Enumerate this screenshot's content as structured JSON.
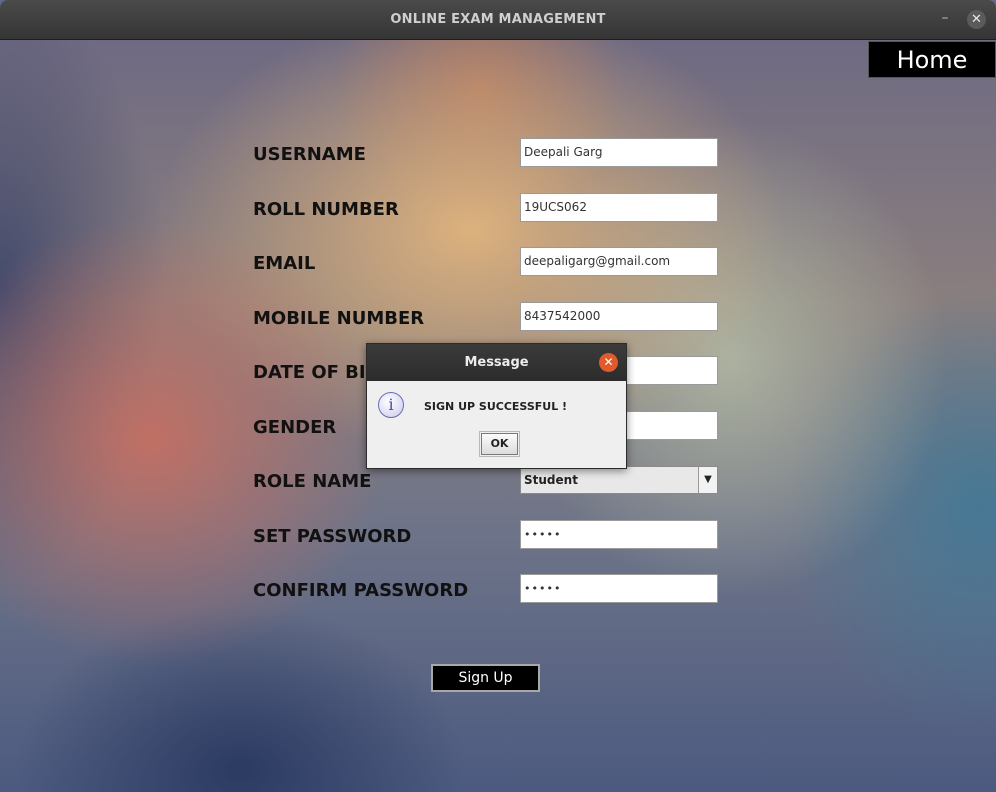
{
  "window": {
    "title": "ONLINE EXAM MANAGEMENT",
    "minimize_glyph": "–",
    "close_glyph": "✕"
  },
  "nav": {
    "home_label": "Home"
  },
  "form": {
    "username": {
      "label": "USERNAME",
      "value": "Deepali Garg"
    },
    "roll_number": {
      "label": "ROLL NUMBER",
      "value": "19UCS062"
    },
    "email": {
      "label": "EMAIL",
      "value": "deepaligarg@gmail.com"
    },
    "mobile_number": {
      "label": "MOBILE NUMBER",
      "value": "8437542000"
    },
    "date_of_birth": {
      "label": "DATE OF BI",
      "value": ""
    },
    "gender": {
      "label": "GENDER",
      "value": ""
    },
    "role_name": {
      "label": "ROLE NAME",
      "value": "Student"
    },
    "set_password": {
      "label": "SET PASSWORD",
      "value": "•••••"
    },
    "confirm_password": {
      "label": "CONFIRM PASSWORD",
      "value": "•••••"
    },
    "submit_label": "Sign Up"
  },
  "dialog": {
    "title": "Message",
    "message": "SIGN UP SUCCESSFUL !",
    "ok_label": "OK",
    "icon": "info-icon",
    "close_glyph": "✕"
  },
  "colors": {
    "titlebar": "#3a3a3a",
    "dialog_close": "#e05a2b",
    "button_bg": "#000000"
  }
}
